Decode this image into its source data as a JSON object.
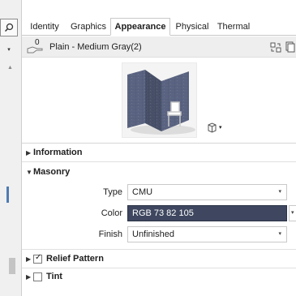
{
  "tabs": [
    {
      "label": "Identity",
      "active": false
    },
    {
      "label": "Graphics",
      "active": false
    },
    {
      "label": "Appearance",
      "active": true
    },
    {
      "label": "Physical",
      "active": false
    },
    {
      "label": "Thermal",
      "active": false
    }
  ],
  "asset": {
    "usage_count": "0",
    "name": "Plain - Medium Gray(2)"
  },
  "sections": {
    "information": {
      "label": "Information",
      "expanded": false
    },
    "masonry": {
      "label": "Masonry",
      "expanded": true
    },
    "relief_pattern": {
      "label": "Relief Pattern",
      "expanded": false,
      "checked": true
    },
    "tint": {
      "label": "Tint",
      "expanded": false,
      "checked": false
    }
  },
  "masonry": {
    "type_label": "Type",
    "type_value": "CMU",
    "color_label": "Color",
    "color_value": "RGB 73 82 105",
    "color_hex": "#495269",
    "finish_label": "Finish",
    "finish_value": "Unfinished"
  },
  "icons": {
    "expanded": "▼",
    "collapsed": "▶",
    "dropdown": "▾",
    "check": "✓",
    "scroll_up": "▲"
  }
}
